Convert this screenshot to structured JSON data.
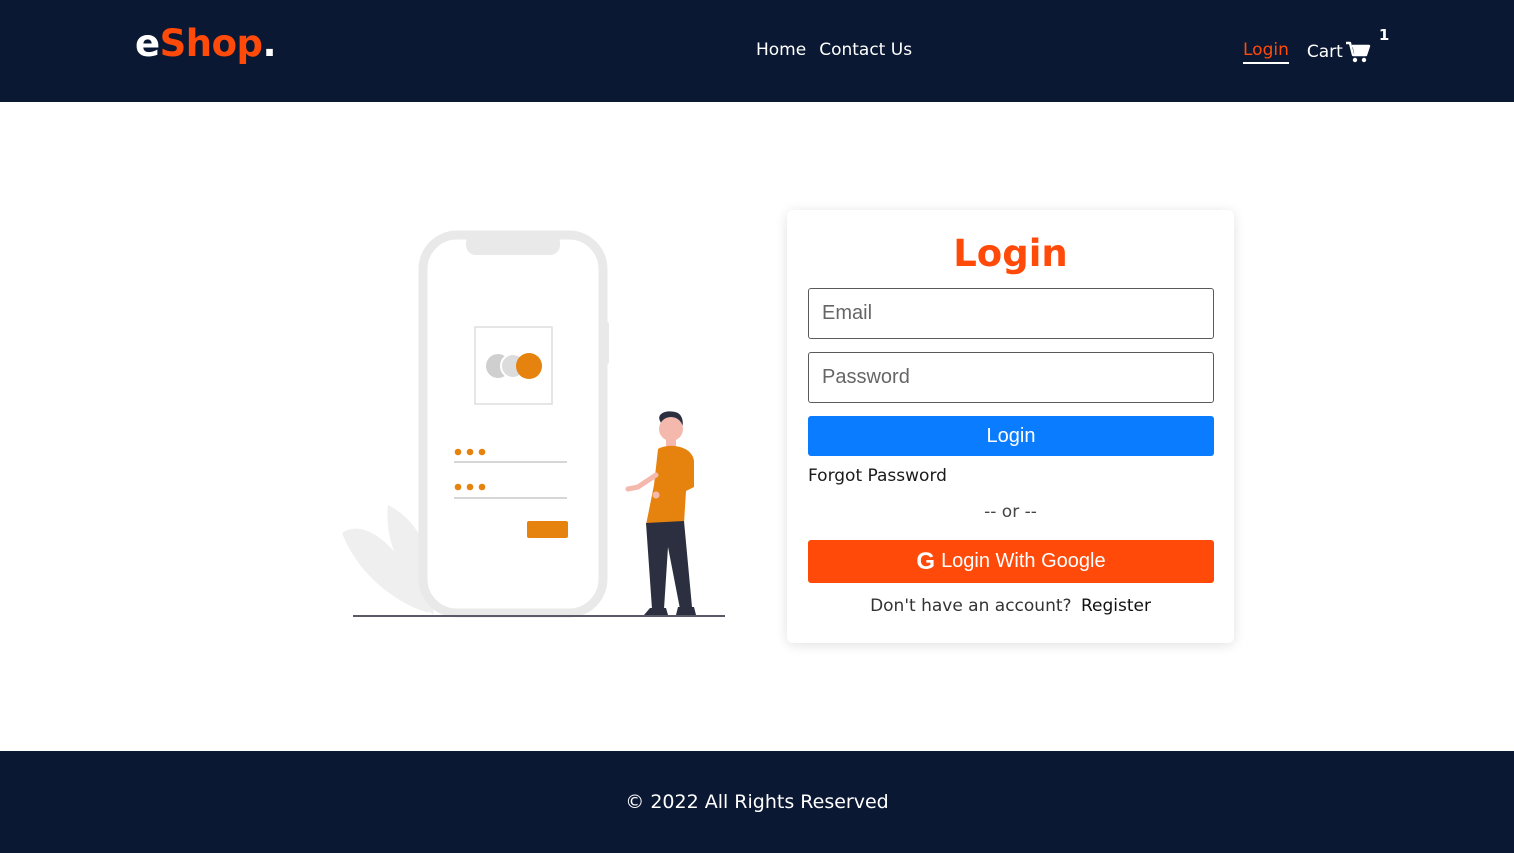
{
  "header": {
    "logo_main": "e",
    "logo_accent": "Shop",
    "logo_dot": ".",
    "nav": {
      "home": "Home",
      "contact": "Contact Us"
    },
    "login": "Login",
    "cart_label": "Cart",
    "cart_count": "1",
    "cart_icon": "cart-icon"
  },
  "login_card": {
    "title": "Login",
    "email_placeholder": "Email",
    "password_placeholder": "Password",
    "login_button": "Login",
    "forgot_password": "Forgot Password",
    "separator": "-- or --",
    "google_icon_glyph": "G",
    "google_button": "Login With Google",
    "register_question": "Don't have an account?",
    "register_link": "Register"
  },
  "footer": {
    "copyright": "© 2022  All Rights Reserved"
  },
  "colors": {
    "brand_dark": "#0a1833",
    "accent": "#ff4a0a",
    "primary_button": "#0a7cff",
    "illustration_accent": "#e6820e"
  }
}
